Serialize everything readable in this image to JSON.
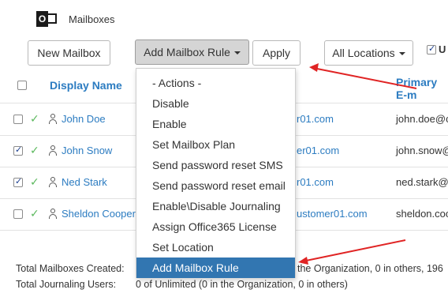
{
  "header": {
    "title": "Mailboxes"
  },
  "toolbar": {
    "new_mailbox": "New Mailbox",
    "add_rule": "Add Mailbox Rule",
    "apply": "Apply",
    "locations": "All Locations"
  },
  "columns": {
    "display_name": "Display Name",
    "primary_email": "Primary E-m"
  },
  "rows": [
    {
      "name": "John Doe",
      "customer": "r01.com",
      "email": "john.doe@c",
      "checked": false
    },
    {
      "name": "John Snow",
      "customer": "er01.com",
      "email": "john.snow@",
      "checked": true
    },
    {
      "name": "Ned Stark",
      "customer": "r01.com",
      "email": "ned.stark@",
      "checked": true
    },
    {
      "name": "Sheldon Cooper",
      "customer": "ustomer01.com",
      "email": "sheldon.coo",
      "checked": false
    }
  ],
  "dropdown": {
    "items": [
      "- Actions -",
      "Disable",
      "Enable",
      "Set Mailbox Plan",
      "Send password reset SMS",
      "Send password reset email",
      "Enable\\Disable Journaling",
      "Assign Office365 License",
      "Set Location",
      "Add Mailbox Rule"
    ],
    "selected": "Add Mailbox Rule"
  },
  "footer": {
    "created_label": "Total Mailboxes Created:",
    "created_value": "the Organization, 0 in others, 196",
    "journaling_label": "Total Journaling Users:",
    "journaling_value": "0 of Unlimited (0 in the Organization, 0 in others)"
  },
  "colors": {
    "link": "#2c7cc1",
    "active_item": "#3276b1",
    "arrow": "#e02424",
    "check": "#5bb85d"
  }
}
